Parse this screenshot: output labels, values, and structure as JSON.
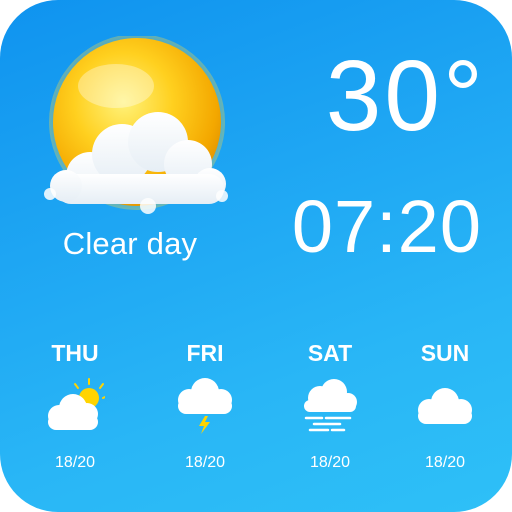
{
  "current": {
    "condition": "Clear day",
    "temperature": "30°",
    "time": "07:20",
    "icon": "sun-behind-cloud-icon"
  },
  "forecast": [
    {
      "day": "THU",
      "temp": "18/20",
      "icon": "partly-sunny-icon"
    },
    {
      "day": "FRI",
      "temp": "18/20",
      "icon": "thunderstorm-icon"
    },
    {
      "day": "SAT",
      "temp": "18/20",
      "icon": "fog-icon"
    },
    {
      "day": "SUN",
      "temp": "18/20",
      "icon": "cloudy-icon"
    }
  ],
  "colors": {
    "background_top": "#0f93ef",
    "background_bottom": "#2ec0f7",
    "sun": "#f7b800",
    "lightning": "#ffd400",
    "text": "#ffffff"
  }
}
